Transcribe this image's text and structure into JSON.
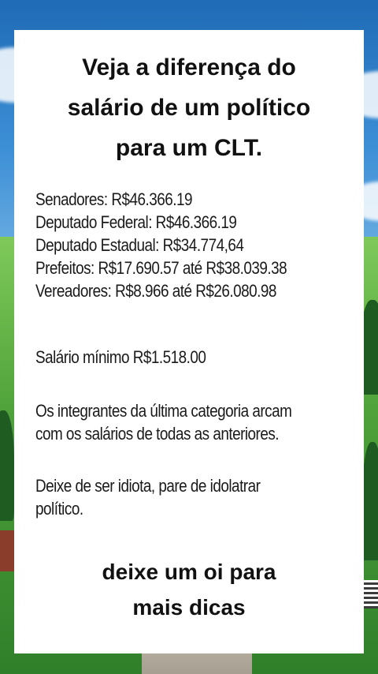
{
  "post": {
    "title_lines": [
      "Veja a diferença do",
      "salário de um político",
      "para um CLT."
    ],
    "salaries": [
      "Senadores: R$46.366.19",
      "Deputado Federal: R$46.366.19",
      "Deputado Estadual: R$34.774,64",
      "Prefeitos: R$17.690.57 até R$38.039.38",
      "Vereadores: R$8.966 até R$26.080.98"
    ],
    "minimum_wage": "Salário mínimo R$1.518.00",
    "paragraph1_lines": [
      "Os integrantes da última categoria arcam",
      "com os salários de todas as anteriores."
    ],
    "paragraph2_lines": [
      "Deixe de ser idiota, pare de idolatrar",
      "político."
    ],
    "footer_lines": [
      "deixe um oi para",
      "mais dicas"
    ]
  }
}
